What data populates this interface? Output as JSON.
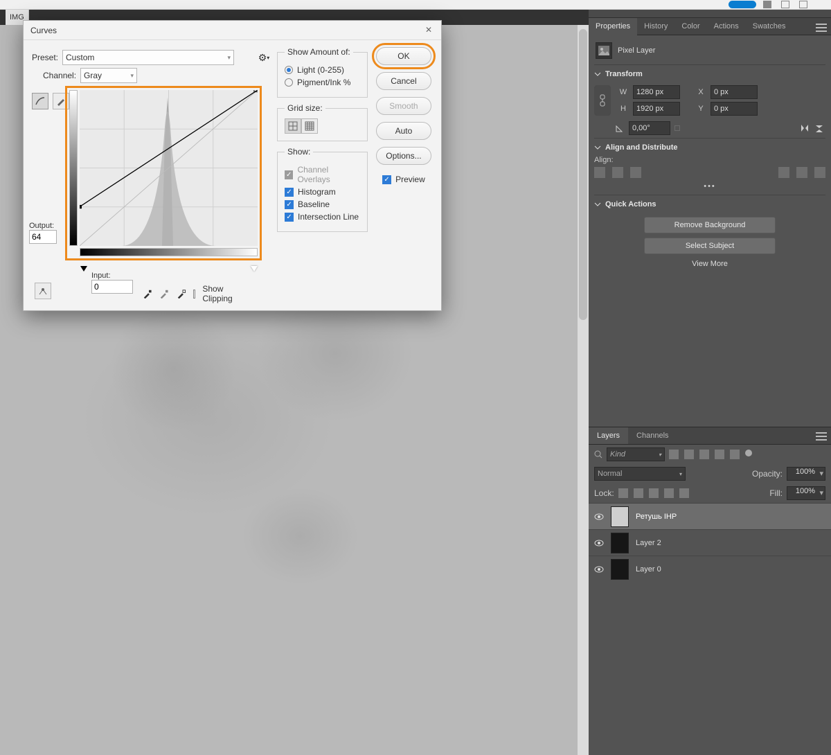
{
  "doc_tab": "IMG",
  "panels": {
    "properties": {
      "tabs": [
        "Properties",
        "History",
        "Color",
        "Actions",
        "Swatches"
      ],
      "active_tab": "Properties",
      "layer_type": "Pixel Layer",
      "sections": {
        "transform": {
          "title": "Transform",
          "w": "1280 px",
          "h": "1920 px",
          "x": "0 px",
          "y": "0 px",
          "angle": "0,00°"
        },
        "align": {
          "title": "Align and Distribute",
          "label": "Align:"
        },
        "quick": {
          "title": "Quick Actions",
          "remove_bg": "Remove Background",
          "select_subject": "Select Subject",
          "view_more": "View More"
        }
      }
    },
    "layers": {
      "tabs": [
        "Layers",
        "Channels"
      ],
      "active_tab": "Layers",
      "kind_label": "Kind",
      "blend_mode": "Normal",
      "opacity_label": "Opacity:",
      "opacity_value": "100%",
      "lock_label": "Lock:",
      "fill_label": "Fill:",
      "fill_value": "100%",
      "items": [
        {
          "name": "Ретушь IHP",
          "selected": true,
          "thumb": "light"
        },
        {
          "name": "Layer 2",
          "selected": false,
          "thumb": "dark"
        },
        {
          "name": "Layer 0",
          "selected": false,
          "thumb": "dark"
        }
      ]
    }
  },
  "curves": {
    "title": "Curves",
    "preset_label": "Preset:",
    "preset_value": "Custom",
    "channel_label": "Channel:",
    "channel_value": "Gray",
    "output_label": "Output:",
    "output_value": "64",
    "input_label": "Input:",
    "input_value": "0",
    "show_clipping": "Show Clipping",
    "show_amount": {
      "legend": "Show Amount of:",
      "light": "Light  (0-255)",
      "pigment": "Pigment/Ink %",
      "selected": "light"
    },
    "grid": {
      "legend": "Grid size:"
    },
    "show": {
      "legend": "Show:",
      "channel_overlays": "Channel Overlays",
      "histogram": "Histogram",
      "baseline": "Baseline",
      "intersection": "Intersection Line"
    },
    "buttons": {
      "ok": "OK",
      "cancel": "Cancel",
      "smooth": "Smooth",
      "auto": "Auto",
      "options": "Options..."
    },
    "preview": "Preview"
  },
  "chart_data": {
    "type": "line",
    "title": "Curves — Gray channel",
    "xlabel": "Input",
    "ylabel": "Output",
    "xlim": [
      0,
      255
    ],
    "ylim": [
      0,
      255
    ],
    "series": [
      {
        "name": "Baseline",
        "x": [
          0,
          255
        ],
        "y": [
          0,
          255
        ]
      },
      {
        "name": "Curve",
        "x": [
          0,
          255
        ],
        "y": [
          64,
          255
        ]
      }
    ],
    "points": [
      {
        "x": 0,
        "y": 64,
        "selected": true
      },
      {
        "x": 255,
        "y": 255,
        "selected": false
      }
    ],
    "histogram_note": "dense sharp peak centered near midtones"
  }
}
